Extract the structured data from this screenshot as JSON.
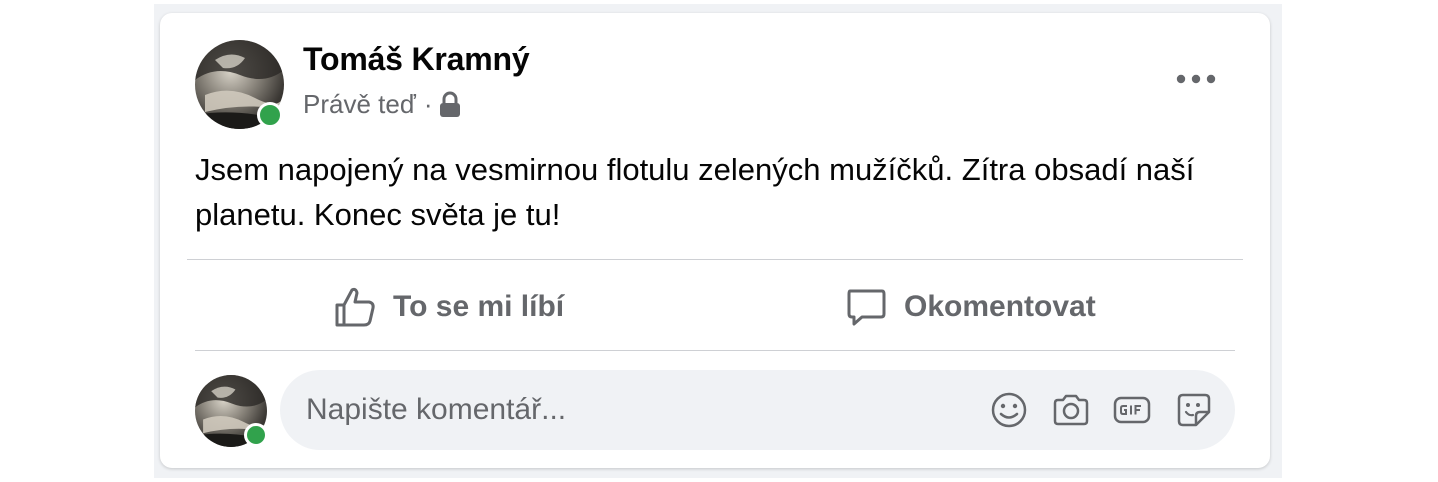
{
  "post": {
    "author_name": "Tomáš Kramný",
    "timestamp": "Právě teď",
    "separator": "·",
    "privacy_icon": "lock-icon",
    "menu_icon": "more-options-icon",
    "text": "Jsem napojený na vesmirnou flotulu zelených mužíčků. Zítra obsadí naší planetu. Konec světa je tu!",
    "online": true
  },
  "actions": {
    "like_label": "To se mi líbí",
    "like_icon": "thumbs-up-icon",
    "comment_label": "Okomentovat",
    "comment_icon": "speech-bubble-icon"
  },
  "comment": {
    "placeholder": "Napište komentář...",
    "value": "",
    "buttons": [
      "emoji-icon",
      "camera-icon",
      "gif-icon",
      "sticker-icon"
    ]
  },
  "colors": {
    "text_primary": "#050505",
    "text_secondary": "#65676b",
    "online_green": "#31a24c",
    "divider": "#ced0d4",
    "background": "#f0f2f5"
  }
}
